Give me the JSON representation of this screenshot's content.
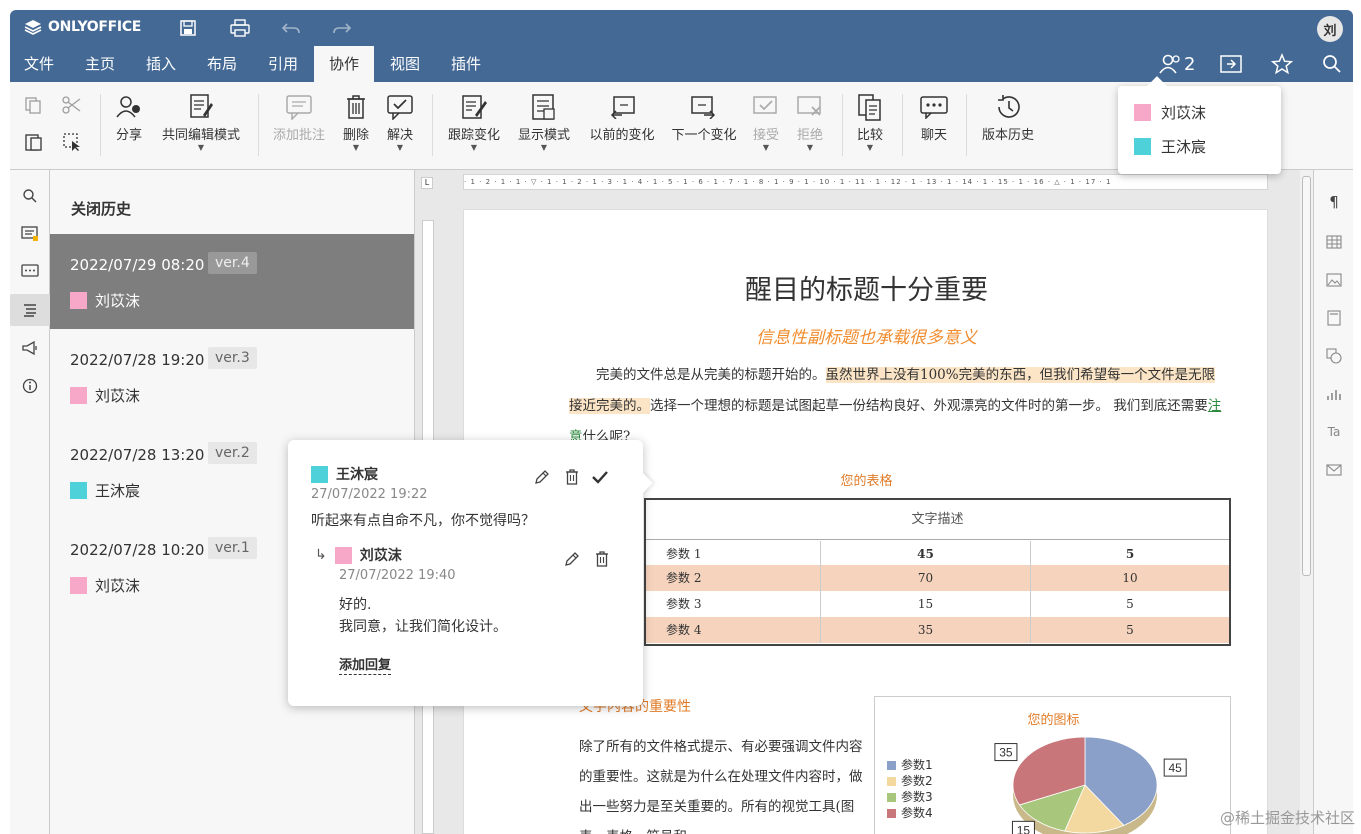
{
  "app": {
    "brand": "ONLYOFFICE",
    "user_initial": "刘",
    "coeditors_count": "2"
  },
  "menu_tabs": [
    "文件",
    "主页",
    "插入",
    "布局",
    "引用",
    "协作",
    "视图",
    "插件"
  ],
  "active_tab": "协作",
  "toolbar": {
    "share": "分享",
    "coedit_mode": "共同编辑模式",
    "add_comment": "添加批注",
    "delete": "删除",
    "resolve": "解决",
    "track_changes": "跟踪变化",
    "display_mode": "显示模式",
    "prev_change": "以前的变化",
    "next_change": "下一个变化",
    "accept": "接受",
    "reject": "拒绝",
    "compare": "比较",
    "chat": "聊天",
    "version_history": "版本历史"
  },
  "coeditors": [
    {
      "name": "刘苡沫",
      "color": "#f7a8c9"
    },
    {
      "name": "王沐宸",
      "color": "#4fd1d9"
    }
  ],
  "history": {
    "close_label": "关闭历史",
    "items": [
      {
        "date": "2022/07/29 08:20",
        "version": "ver.4",
        "user": "刘苡沫",
        "color": "#f7a8c9"
      },
      {
        "date": "2022/07/28 19:20",
        "version": "ver.3",
        "user": "刘苡沫",
        "color": "#f7a8c9"
      },
      {
        "date": "2022/07/28 13:20",
        "version": "ver.2",
        "user": "王沐宸",
        "color": "#4fd1d9"
      },
      {
        "date": "2022/07/28 10:20",
        "version": "ver.1",
        "user": "刘苡沫",
        "color": "#f7a8c9"
      }
    ]
  },
  "document": {
    "title": "醒目的标题十分重要",
    "subtitle": "信息性副标题也承载很多意义",
    "para1_a": "完美的文件总是从完美的标题开始的。",
    "para1_hl": "虽然世界上没有100%完美的东西，但我们希望每一个文件是无限接近完美的。",
    "para1_b": "选择一个理想的标题是试图起草一份结构良好、外观漂亮的文件时的第一步。 我们到底还需要",
    "para1_link": "注意",
    "para1_c": "什么呢?",
    "table_caption": "您的表格",
    "table_header": "文字描述",
    "table_rows": [
      [
        "参数 1",
        "45",
        "5"
      ],
      [
        "参数 2",
        "70",
        "10"
      ],
      [
        "参数 3",
        "15",
        "5"
      ],
      [
        "参数 4",
        "35",
        "5"
      ]
    ],
    "section_title": "文字内容的重要性",
    "para2": "除了所有的文件格式提示、有必要强调文件内容的重要性。这就是为什么在处理文件内容时，做出一些努力是至关重要的。所有的视觉工具(图表、表格、符号和",
    "chart_title": "您的图标"
  },
  "chart_data": {
    "type": "pie",
    "title": "您的图标",
    "categories": [
      "参数1",
      "参数2",
      "参数3",
      "参数4"
    ],
    "values": [
      45,
      15,
      15,
      35
    ],
    "colors": [
      "#8aa0c8",
      "#f3d9a0",
      "#a8c77c",
      "#c9767a"
    ]
  },
  "comment": {
    "author": "王沐宸",
    "author_color": "#4fd1d9",
    "date": "27/07/2022 19:22",
    "text": "听起来有点自命不凡，你不觉得吗？",
    "reply_author": "刘苡沫",
    "reply_color": "#f7a8c9",
    "reply_date": "27/07/2022 19:40",
    "reply_line1": "好的.",
    "reply_line2": "我同意，让我们简化设计。",
    "add_reply": "添加回复"
  },
  "watermark": "@稀土掘金技术社区"
}
